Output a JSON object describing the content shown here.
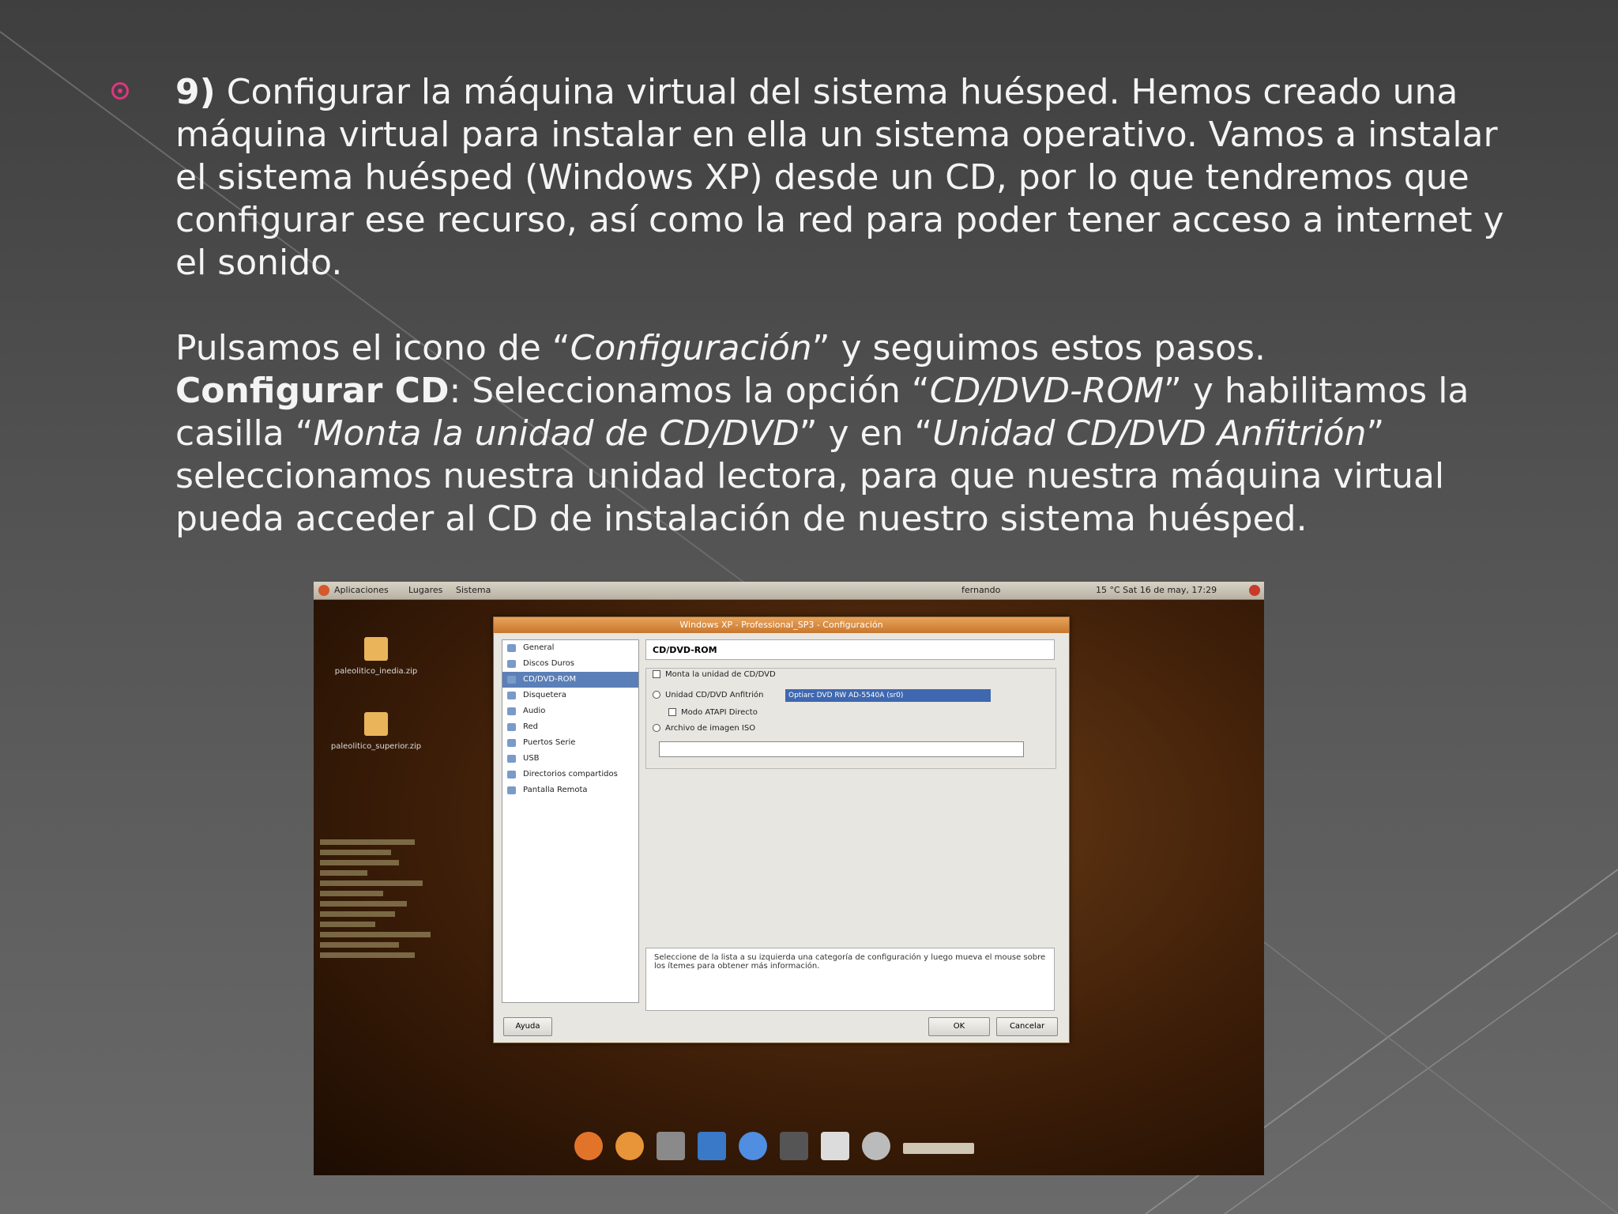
{
  "slide": {
    "step_number": "9)",
    "paragraph1": " Configurar la máquina virtual del sistema huésped. Hemos creado una máquina virtual para instalar en ella un sistema operativo. Vamos a instalar el sistema huésped (Windows XP) desde un CD, por lo que tendremos que configurar ese recurso, así como la red para poder tener acceso a internet y el sonido.",
    "p2_before": "Pulsamos el icono de “",
    "p2_italic": "Configuración",
    "p2_after": "” y seguimos estos pasos.",
    "p3_bold": "Configurar CD",
    "p3_t1": ": Seleccionamos la opción “",
    "p3_i1": "CD/DVD-ROM",
    "p3_t2": "” y habilitamos la casilla “",
    "p3_i2": "Monta la unidad de CD/DVD",
    "p3_t3": "” y en “",
    "p3_i3": "Unidad CD/DVD Anfitrión",
    "p3_t4": "” seleccionamos nuestra unidad lectora, para que nuestra máquina virtual pueda acceder al CD de instalación de nuestro sistema huésped.",
    "accent_color": "#e0357f"
  },
  "screenshot": {
    "panel": {
      "menu1": "Aplicaciones",
      "menu2": "Lugares",
      "menu3": "Sistema",
      "user": "fernando",
      "clock": "15 °C  Sat 16 de may, 17:29"
    },
    "desktop_icons": [
      {
        "label": "paleolitico_inedia.zip"
      },
      {
        "label": "paleolitico_superior.zip"
      }
    ],
    "dialog": {
      "title": "Windows XP - Professional_SP3 - Configuración",
      "sidebar": [
        "General",
        "Discos Duros",
        "CD/DVD-ROM",
        "Disquetera",
        "Audio",
        "Red",
        "Puertos Serie",
        "USB",
        "Directorios compartidos",
        "Pantalla Remota"
      ],
      "selected_index": 2,
      "section_title": "CD/DVD-ROM",
      "mount_checkbox": "Monta la unidad de CD/DVD",
      "host_drive_label": "Unidad CD/DVD Anfitrión",
      "host_drive_value": "Optiarc DVD RW AD-5540A (sr0)",
      "passthrough_label": "Modo ATAPI Directo",
      "iso_label": "Archivo de imagen ISO",
      "description": "Seleccione de la lista a su izquierda una categoría de configuración y luego mueva el mouse sobre los ítemes para obtener más información.",
      "help_button": "Ayuda",
      "ok_button": "OK",
      "cancel_button": "Cancelar"
    }
  }
}
